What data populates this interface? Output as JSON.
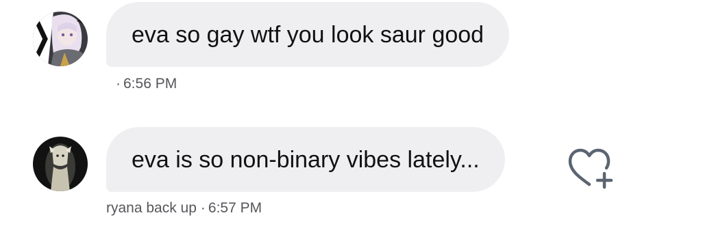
{
  "messages": [
    {
      "text": "eva so gay wtf you look saur good",
      "sender": "",
      "time": "6:56 PM",
      "separator": "·"
    },
    {
      "text": "eva is so non-binary vibes lately...",
      "sender": "ryana back up",
      "time": "6:57 PM",
      "separator": "·"
    }
  ],
  "icons": {
    "react": "heart-plus-icon"
  },
  "colors": {
    "bubble": "#efeff1",
    "text": "#111111",
    "meta": "#55565a",
    "icon": "#5b6470"
  }
}
